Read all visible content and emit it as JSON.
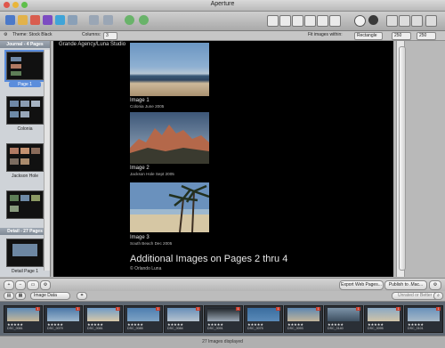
{
  "app": {
    "title": "Aperture"
  },
  "colors": {
    "accent": "#5b8ddc",
    "badge": "#c43a2b",
    "canvas_bg": "#000000"
  },
  "secbar": {
    "theme_label": "Theme: Stock Black",
    "columns_label": "Columns:",
    "columns_value": "3",
    "fit_label": "Fit images within:",
    "fit_value": "Rectangle",
    "width_value": "250",
    "height_value": "250"
  },
  "sidebar": {
    "album1": "Journal - 4 Pages",
    "album2": "Detail - 27 Pages",
    "pages": [
      {
        "label": "Page 1"
      },
      {
        "label": "Colonia"
      },
      {
        "label": "Jackson Hole"
      },
      {
        "label": ""
      },
      {
        "label": "Detail Page 1"
      }
    ]
  },
  "canvas": {
    "heading": "Grande Agency/Luna Studio",
    "images": [
      {
        "title": "Image 1",
        "subtitle": "Colonia June 2005"
      },
      {
        "title": "Image 2",
        "subtitle": "Jackson Hole Sept 2005"
      },
      {
        "title": "Image 3",
        "subtitle": "South Beach Dec 2005"
      }
    ],
    "footer_title": "Additional Images on Pages 2 thru 4",
    "copyright": "© Orlando Luna"
  },
  "bottom": {
    "export_label": "Export Web Pages...",
    "publish_label": "Publish to .Mac...",
    "filter_label": "Image Data",
    "search_placeholder": "Unrated or Better"
  },
  "filmstrip": {
    "items": [
      {
        "name": "DSC_0081",
        "stars": "★★★★★",
        "badge": "1"
      },
      {
        "name": "DSC_0079",
        "stars": "★★★★★",
        "badge": "1"
      },
      {
        "name": "DSC_0081",
        "stars": "★★★★★",
        "badge": "1"
      },
      {
        "name": "DSC_0085",
        "stars": "★★★★★",
        "badge": "1"
      },
      {
        "name": "DSC_0084",
        "stars": "★★★★★",
        "badge": "1"
      },
      {
        "name": "DSC_0091",
        "stars": "★★★★★",
        "badge": "1"
      },
      {
        "name": "DSC_0075",
        "stars": "★★★★★",
        "badge": "1"
      },
      {
        "name": "DSC_0093",
        "stars": "★★★★★",
        "badge": "1"
      },
      {
        "name": "DSC_0140",
        "stars": "★★★★★",
        "badge": "1"
      },
      {
        "name": "DSC_0095",
        "stars": "★★★★★",
        "badge": "1"
      },
      {
        "name": "DSC_0101",
        "stars": "★★★★★",
        "badge": "1"
      }
    ],
    "status": "27 Images displayed"
  }
}
